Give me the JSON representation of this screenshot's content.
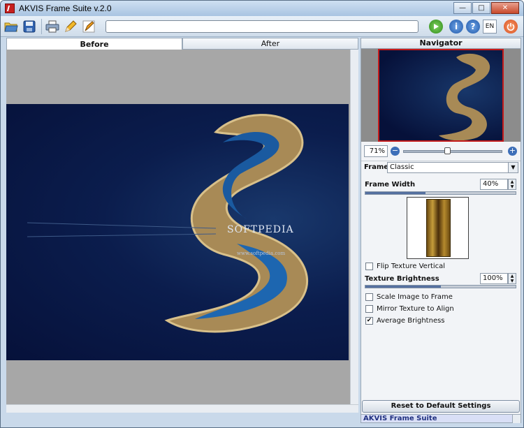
{
  "window": {
    "title": "AKVIS Frame Suite v.2.0"
  },
  "toolbar": {
    "language": "EN"
  },
  "tabs": [
    {
      "label": "Before"
    },
    {
      "label": "After"
    }
  ],
  "canvas": {
    "watermark": "SOFTPEDIA",
    "watermark_url": "www.softpedia.com"
  },
  "navigator": {
    "title": "Navigator",
    "zoom": "71%"
  },
  "frame": {
    "label": "Frame",
    "selected": "Classic"
  },
  "frame_width": {
    "label": "Frame Width",
    "value": "40%",
    "level": 0.4
  },
  "options": {
    "flip_texture_vertical": {
      "label": "Flip Texture Vertical",
      "checked": false
    },
    "scale_image": {
      "label": "Scale Image to Frame",
      "checked": false
    },
    "mirror_texture": {
      "label": "Mirror Texture to Align",
      "checked": false
    },
    "average_brightness": {
      "label": "Average Brightness",
      "checked": true
    }
  },
  "texture_brightness": {
    "label": "Texture Brightness",
    "value": "100%",
    "level": 0.5
  },
  "reset_button": "Reset to Default Settings",
  "footer": {
    "label": "AKVIS Frame Suite"
  },
  "colors": {
    "accent": "#3d6fb8",
    "close": "#c84a2c",
    "frame_selection": "#c41a1a"
  }
}
